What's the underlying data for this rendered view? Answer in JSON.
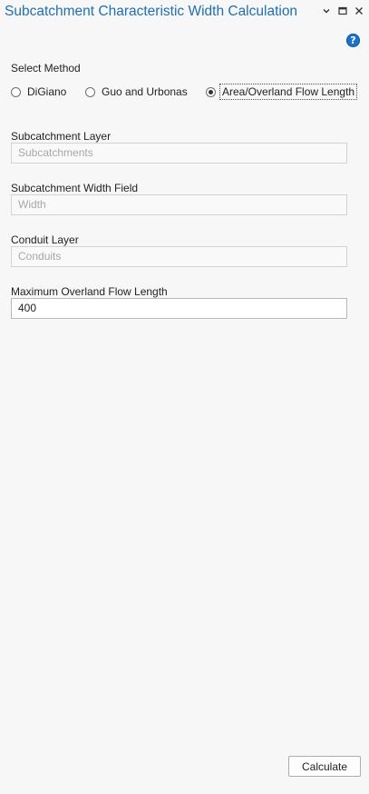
{
  "window": {
    "title": "Subcatchment Characteristic Width Calculation",
    "controls": [
      "chevron-down-icon",
      "maximize-icon",
      "close-icon"
    ]
  },
  "help": {
    "glyph": "?",
    "icon": "help-icon"
  },
  "method": {
    "label": "Select Method",
    "options": [
      {
        "label": "DiGiano",
        "checked": false
      },
      {
        "label": "Guo and Urbonas",
        "checked": false
      },
      {
        "label": "Area/Overland Flow Length",
        "checked": true
      }
    ]
  },
  "fields": {
    "subcatchment_layer": {
      "label": "Subcatchment Layer",
      "placeholder": "Subcatchments"
    },
    "width_field": {
      "label": "Subcatchment Width Field",
      "placeholder": "Width"
    },
    "conduit_layer": {
      "label": "Conduit Layer",
      "placeholder": "Conduits"
    },
    "max_flow_length": {
      "label": "Maximum Overland Flow Length",
      "value": "400"
    }
  },
  "actions": {
    "calculate_label": "Calculate"
  },
  "colors": {
    "title": "#1f6fb2",
    "help_icon": "#1a73c8",
    "background": "#f7f7f7"
  }
}
